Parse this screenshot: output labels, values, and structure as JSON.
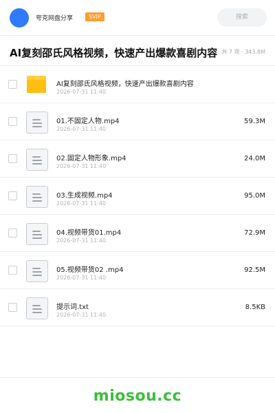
{
  "header": {
    "share_name": "夸克网盘分享",
    "badge": "SVIP",
    "search_placeholder": "搜索"
  },
  "folder": {
    "title": "AI复刻邵氏风格视频，快速产出爆款喜剧内容",
    "summary": "共 7 项 · 343.8M"
  },
  "files": [
    {
      "type": "folder",
      "icon": "folder-icon",
      "name": "AI复刻邵氏风格视频，快速产出爆款喜剧内容",
      "date": "2026-07-31 11:40",
      "size": ""
    },
    {
      "type": "file",
      "icon": "document-icon",
      "name": "01.不固定人物.mp4",
      "date": "2026-07-31 11:40",
      "size": "59.3M"
    },
    {
      "type": "file",
      "icon": "document-icon",
      "name": "02.固定人物形象.mp4",
      "date": "2026-07-31 11:40",
      "size": "24.0M"
    },
    {
      "type": "file",
      "icon": "document-icon",
      "name": "03.生成视频.mp4",
      "date": "2026-07-31 11:40",
      "size": "95.0M"
    },
    {
      "type": "file",
      "icon": "document-icon",
      "name": "04.视频带货01.mp4",
      "date": "2026-07-31 11:40",
      "size": "72.9M"
    },
    {
      "type": "file",
      "icon": "document-icon",
      "name": "05.视频带货02  .mp4",
      "date": "2026-07-31 11:40",
      "size": "92.5M"
    },
    {
      "type": "file",
      "icon": "document-icon",
      "name": "提示词.txt",
      "date": "2026-07-31 11:40",
      "size": "8.5KB"
    }
  ],
  "footer": {
    "brand": "miosou.cc"
  },
  "colors": {
    "accent_blue": "#2f7bff",
    "svip_orange": "#ff9d2e",
    "folder_yellow": "#ffbe12",
    "brand_green": "#3bbf3b"
  }
}
